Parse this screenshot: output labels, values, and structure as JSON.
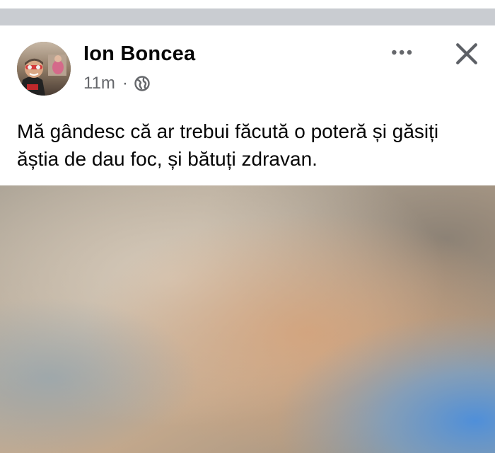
{
  "post": {
    "author_name": "Ion Boncea",
    "timestamp": "11m",
    "separator": "·",
    "audience_icon": "globe-icon",
    "more_icon": "more-dots-icon",
    "close_icon": "close-icon",
    "text": "Mă gândesc că ar trebui făcută o poteră și găsiți ăștia de dau foc, și bătuți zdravan.",
    "photo_subject": "smoke-sky-photo"
  },
  "colors": {
    "text_primary": "#050505",
    "text_secondary": "#65676b",
    "divider": "#c9ccd1"
  }
}
